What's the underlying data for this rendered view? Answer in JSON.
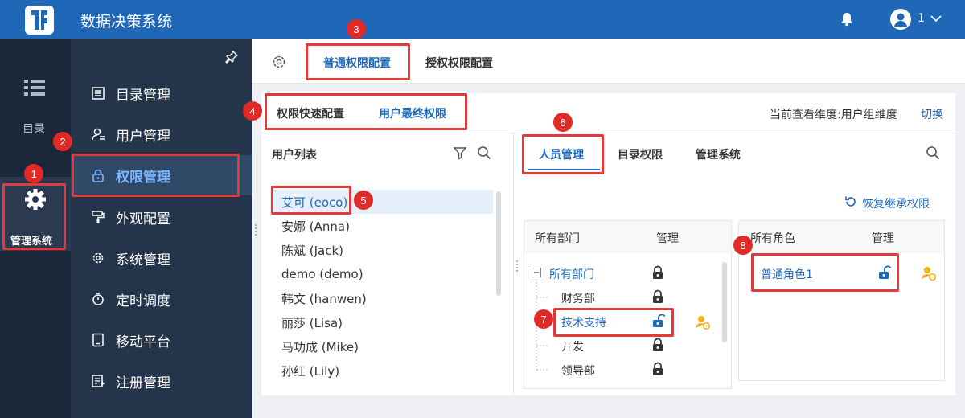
{
  "app": {
    "title": "数据决策系统",
    "user_label": "1"
  },
  "rail": {
    "menu_label": "目录",
    "mgmt_label": "管理系统"
  },
  "sidebar": {
    "items": [
      {
        "label": "目录管理",
        "icon": "list-icon"
      },
      {
        "label": "用户管理",
        "icon": "user-icon"
      },
      {
        "label": "权限管理",
        "icon": "lock-icon",
        "active": true
      },
      {
        "label": "外观配置",
        "icon": "paint-roller-icon"
      },
      {
        "label": "系统管理",
        "icon": "gear-icon"
      },
      {
        "label": "定时调度",
        "icon": "timer-icon"
      },
      {
        "label": "移动平台",
        "icon": "tablet-icon"
      },
      {
        "label": "注册管理",
        "icon": "register-icon"
      }
    ]
  },
  "tabs": {
    "normal": "普通权限配置",
    "grant": "授权权限配置"
  },
  "subtabs": {
    "quick": "权限快速配置",
    "final": "用户最终权限",
    "dimension": "当前查看维度:用户组维度",
    "switch": "切换"
  },
  "user_list": {
    "title": "用户列表",
    "users": [
      "艾可 (eoco)",
      "安娜 (Anna)",
      "陈斌 (Jack)",
      "demo (demo)",
      "韩文 (hanwen)",
      "丽莎 (Lisa)",
      "马功成 (Mike)",
      "孙红 (Lily)"
    ]
  },
  "perm_tabs": {
    "people": "人员管理",
    "catalog": "目录权限",
    "mgmt": "管理系统"
  },
  "restore": "恢复继承权限",
  "dept": {
    "header_name": "所有部门",
    "header_mgr": "管理",
    "nodes": [
      "所有部门",
      "财务部",
      "技术支持",
      "开发",
      "领导部"
    ]
  },
  "role": {
    "header_name": "所有角色",
    "header_mgr": "管理",
    "items": [
      "普通角色1"
    ]
  },
  "badges": [
    "1",
    "2",
    "3",
    "4",
    "5",
    "6",
    "7",
    "8"
  ],
  "colors": {
    "primary": "#1f68b8",
    "sidebar": "#24344a",
    "rail": "#1c2839",
    "highlight": "#e03a3a",
    "unlocked": "#1f68b8"
  }
}
